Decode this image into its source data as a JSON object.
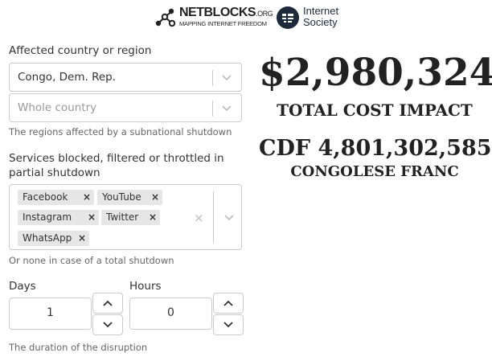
{
  "logos": {
    "netblocks_name": "NETBLOCKS",
    "netblocks_tld": ".ORG",
    "netblocks_tagline": "MAPPING INTERNET FREEDOM",
    "isoc_line1": "Internet",
    "isoc_line2": "Society"
  },
  "form": {
    "country_label": "Affected country or region",
    "country_value": "Congo, Dem. Rep.",
    "region_placeholder": "Whole country",
    "region_hint": "The regions affected by a subnational shutdown",
    "services_label_line1": "Services blocked, filtered or throttled in",
    "services_label_line2": "partial shutdown",
    "services": [
      "Facebook",
      "YouTube",
      "Instagram",
      "Twitter",
      "WhatsApp"
    ],
    "services_hint": "Or none in case of a total shutdown",
    "days_label": "Days",
    "days_value": "1",
    "hours_label": "Hours",
    "hours_value": "0",
    "duration_hint": "The duration of the disruption"
  },
  "results": {
    "usd_value": "$2,980,324",
    "usd_caption": "TOTAL COST IMPACT",
    "local_value": "CDF 4,801,302,585",
    "local_caption": "CONGOLESE FRANC"
  },
  "icons": {
    "tag_remove": "×",
    "clear_all": "×"
  }
}
